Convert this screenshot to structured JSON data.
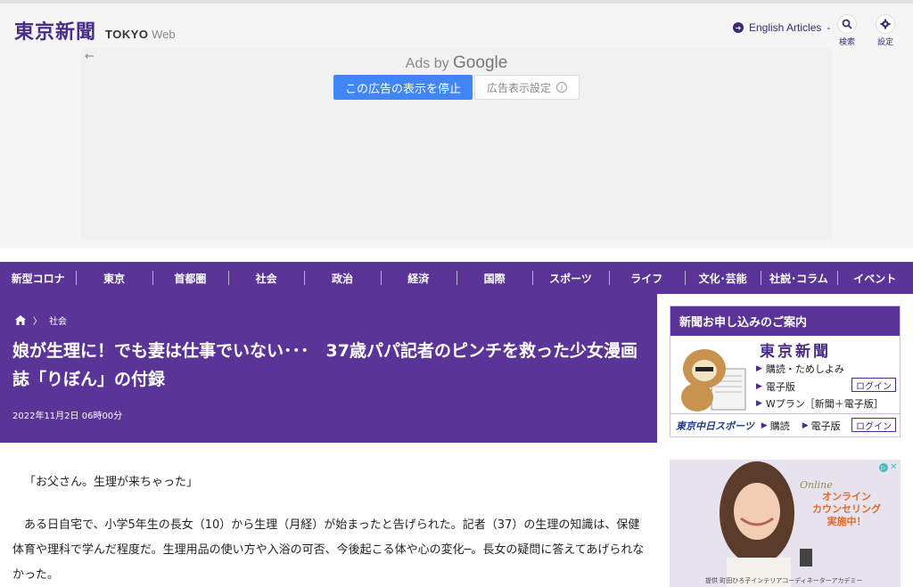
{
  "header": {
    "logo_jp": "東京新聞",
    "logo_en_bold": "TOKYO",
    "logo_en_light": "Web",
    "english_link": "English Articles",
    "search_label": "検索",
    "settings_label": "設定"
  },
  "ad": {
    "ads_by": "Ads by ",
    "google": "Google",
    "stop_button": "この広告の表示を停止",
    "settings_button": "広告表示設定"
  },
  "nav": {
    "items": [
      "新型コロナ",
      "東京",
      "首都圏",
      "社会",
      "政治",
      "経済",
      "国際",
      "スポーツ",
      "ライフ",
      "文化･芸能",
      "社説･コラム",
      "イベント"
    ]
  },
  "article": {
    "breadcrumb_category": "社会",
    "title": "娘が生理に！でも妻は仕事でいない･･･　37歳パパ記者のピンチを救った少女漫画誌「りぼん」の付録",
    "date": "2022年11月2日 06時00分",
    "paragraphs": [
      "「お父さん。生理が来ちゃった」",
      "ある日自宅で、小学5年生の長女（10）から生理（月経）が始まったと告げられた。記者（37）の生理の知識は、保健体育や理科で学んだ程度だ。生理用品の使い方や入浴の可否、今後起こる体や心の変化─。長女の疑問に答えてあげられなかった。"
    ]
  },
  "sidebar": {
    "subscribe_title": "新聞お申し込みのご案内",
    "subscribe_logo": "東京新聞",
    "rows": [
      "購読・ためしよみ",
      "電子版",
      "Wプラン［新聞＋電子版］"
    ],
    "login_label": "ログイン",
    "sports_logo": "東京中日スポーツ",
    "foot_items": [
      "購読",
      "電子版"
    ],
    "foot_login": "ログイン",
    "ad_online": "Online",
    "ad_copy_lines": [
      "オンライン",
      "カウンセリング",
      "実施中！"
    ],
    "ad_credit": "提供 町田ひろ子インテリアコーディネーターアカデミー"
  },
  "colors": {
    "brand_purple": "#5a3597",
    "google_blue": "#4285f4"
  }
}
